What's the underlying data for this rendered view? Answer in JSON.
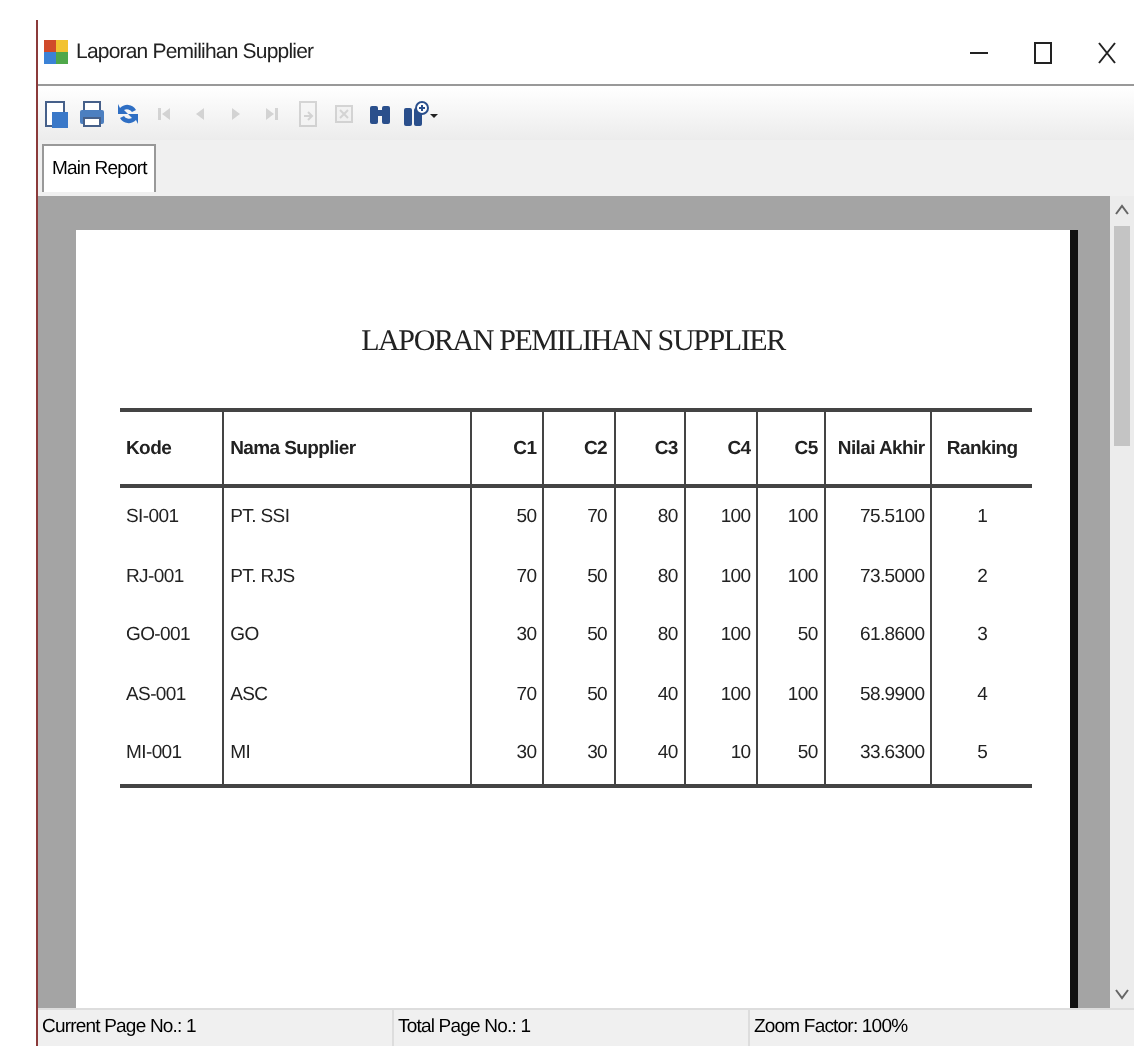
{
  "window": {
    "title": "Laporan Pemilihan Supplier"
  },
  "toolbar": [
    {
      "kind": "export",
      "disabled": false
    },
    {
      "kind": "print",
      "disabled": false
    },
    {
      "kind": "refresh",
      "disabled": false
    },
    {
      "kind": "first",
      "disabled": true
    },
    {
      "kind": "previous",
      "disabled": true
    },
    {
      "kind": "next",
      "disabled": true
    },
    {
      "kind": "last",
      "disabled": true
    },
    {
      "kind": "goto",
      "disabled": true
    },
    {
      "kind": "stop",
      "disabled": true
    },
    {
      "kind": "find",
      "disabled": false
    },
    {
      "kind": "zoom",
      "disabled": false
    }
  ],
  "tabs": [
    {
      "label": "Main Report",
      "selected": true
    }
  ],
  "report": {
    "title": "LAPORAN PEMILIHAN SUPPLIER",
    "columns": [
      "Kode",
      "Nama Supplier",
      "C1",
      "C2",
      "C3",
      "C4",
      "C5",
      "Nilai Akhir",
      "Ranking"
    ],
    "rows": [
      [
        "SI-001",
        "PT. SSI",
        "50",
        "70",
        "80",
        "100",
        "100",
        "75.5100",
        "1"
      ],
      [
        "RJ-001",
        "PT. RJS",
        "70",
        "50",
        "80",
        "100",
        "100",
        "73.5000",
        "2"
      ],
      [
        "GO-001",
        "GO",
        "30",
        "50",
        "80",
        "100",
        "50",
        "61.8600",
        "3"
      ],
      [
        "AS-001",
        "ASC",
        "70",
        "50",
        "40",
        "100",
        "100",
        "58.9900",
        "4"
      ],
      [
        "MI-001",
        "MI",
        "30",
        "30",
        "40",
        "10",
        "50",
        "33.6300",
        "5"
      ]
    ]
  },
  "status_bar": [
    "Current Page No.: 1",
    "Total Page No.: 1",
    "Zoom Factor: 100%"
  ]
}
